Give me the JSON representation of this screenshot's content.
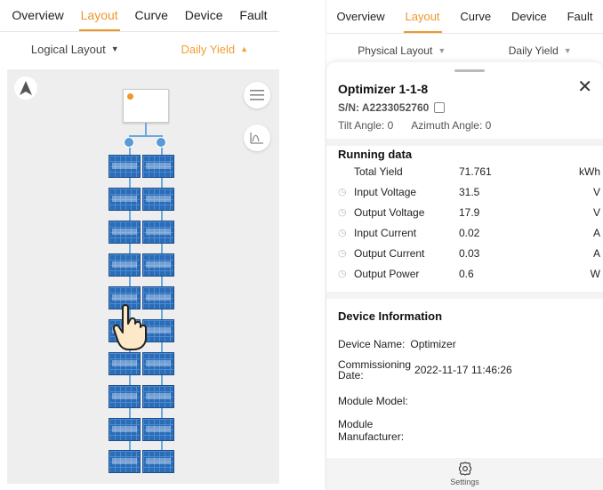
{
  "left": {
    "tabs": [
      "Overview",
      "Layout",
      "Curve",
      "Device",
      "Fault"
    ],
    "active_tab": "Layout",
    "layout_select": "Logical Layout",
    "metric_select": "Daily Yield"
  },
  "right": {
    "tabs": [
      "Overview",
      "Layout",
      "Curve",
      "Device",
      "Fault"
    ],
    "active_tab": "Layout",
    "layout_select": "Physical Layout",
    "metric_select": "Daily Yield",
    "detail": {
      "title": "Optimizer 1-1-8",
      "sn_label": "S/N: A2233052760",
      "tilt": "Tilt Angle: 0",
      "azimuth": "Azimuth Angle: 0",
      "running_title": "Running data",
      "rows": [
        {
          "label": "Total Yield",
          "value": "71.761",
          "unit": "kWh"
        },
        {
          "label": "Input Voltage",
          "value": "31.5",
          "unit": "V"
        },
        {
          "label": "Output Voltage",
          "value": "17.9",
          "unit": "V"
        },
        {
          "label": "Input Current",
          "value": "0.02",
          "unit": "A"
        },
        {
          "label": "Output Current",
          "value": "0.03",
          "unit": "A"
        },
        {
          "label": "Output Power",
          "value": "0.6",
          "unit": "W"
        }
      ],
      "device_info_title": "Device Information",
      "device_name_label": "Device Name:",
      "device_name_value": "Optimizer",
      "commissioning_label_1": "Commissioning",
      "commissioning_label_2": "Date:",
      "commissioning_value": "2022-11-17 11:46:26",
      "module_model_label": "Module Model:",
      "module_manufacturer_label_1": "Module",
      "module_manufacturer_label_2": "Manufacturer:"
    },
    "settings_label": "Settings"
  },
  "colors": {
    "accent": "#f0962b",
    "panel_blue": "#2b6cb5",
    "line_blue": "#6fa8dc"
  }
}
